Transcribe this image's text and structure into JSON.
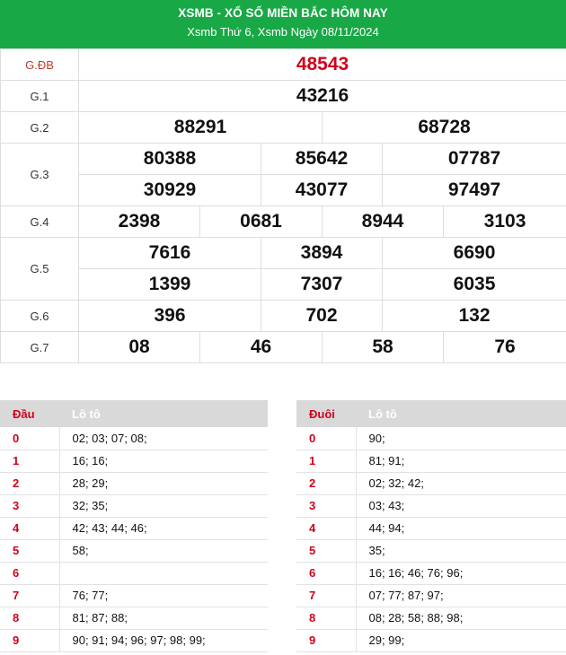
{
  "header": {
    "title": "XSMB - XỔ SỐ MIỀN BẮC HÔM NAY",
    "subtitle": "Xsmb Thứ 6, Xsmb Ngày 08/11/2024"
  },
  "results": {
    "gdb": {
      "label": "G.ĐB",
      "numbers": [
        "48543"
      ]
    },
    "g1": {
      "label": "G.1",
      "numbers": [
        "43216"
      ]
    },
    "g2": {
      "label": "G.2",
      "numbers": [
        "88291",
        "68728"
      ]
    },
    "g3": {
      "label": "G.3",
      "numbers": [
        "80388",
        "85642",
        "07787",
        "30929",
        "43077",
        "97497"
      ]
    },
    "g4": {
      "label": "G.4",
      "numbers": [
        "2398",
        "0681",
        "8944",
        "3103"
      ]
    },
    "g5": {
      "label": "G.5",
      "numbers": [
        "7616",
        "3894",
        "6690",
        "1399",
        "7307",
        "6035"
      ]
    },
    "g6": {
      "label": "G.6",
      "numbers": [
        "396",
        "702",
        "132"
      ]
    },
    "g7": {
      "label": "G.7",
      "numbers": [
        "08",
        "46",
        "58",
        "76"
      ]
    }
  },
  "dau_table": {
    "header_key": "Đầu",
    "header_value": "Lô tô",
    "rows": [
      {
        "key": "0",
        "value": "02; 03; 07; 08;"
      },
      {
        "key": "1",
        "value": "16; 16;"
      },
      {
        "key": "2",
        "value": "28; 29;"
      },
      {
        "key": "3",
        "value": "32; 35;"
      },
      {
        "key": "4",
        "value": "42; 43; 44; 46;"
      },
      {
        "key": "5",
        "value": "58;"
      },
      {
        "key": "6",
        "value": ""
      },
      {
        "key": "7",
        "value": "76; 77;"
      },
      {
        "key": "8",
        "value": "81; 87; 88;"
      },
      {
        "key": "9",
        "value": "90; 91; 94; 96; 97; 98; 99;"
      }
    ]
  },
  "duoi_table": {
    "header_key": "Đuôi",
    "header_value": "Lô tô",
    "rows": [
      {
        "key": "0",
        "value": "90;"
      },
      {
        "key": "1",
        "value": "81; 91;"
      },
      {
        "key": "2",
        "value": "02; 32; 42;"
      },
      {
        "key": "3",
        "value": "03; 43;"
      },
      {
        "key": "4",
        "value": "44; 94;"
      },
      {
        "key": "5",
        "value": "35;"
      },
      {
        "key": "6",
        "value": "16; 16; 46; 76; 96;"
      },
      {
        "key": "7",
        "value": "07; 77; 87; 97;"
      },
      {
        "key": "8",
        "value": "08; 28; 58; 88; 98;"
      },
      {
        "key": "9",
        "value": "29; 99;"
      }
    ]
  }
}
